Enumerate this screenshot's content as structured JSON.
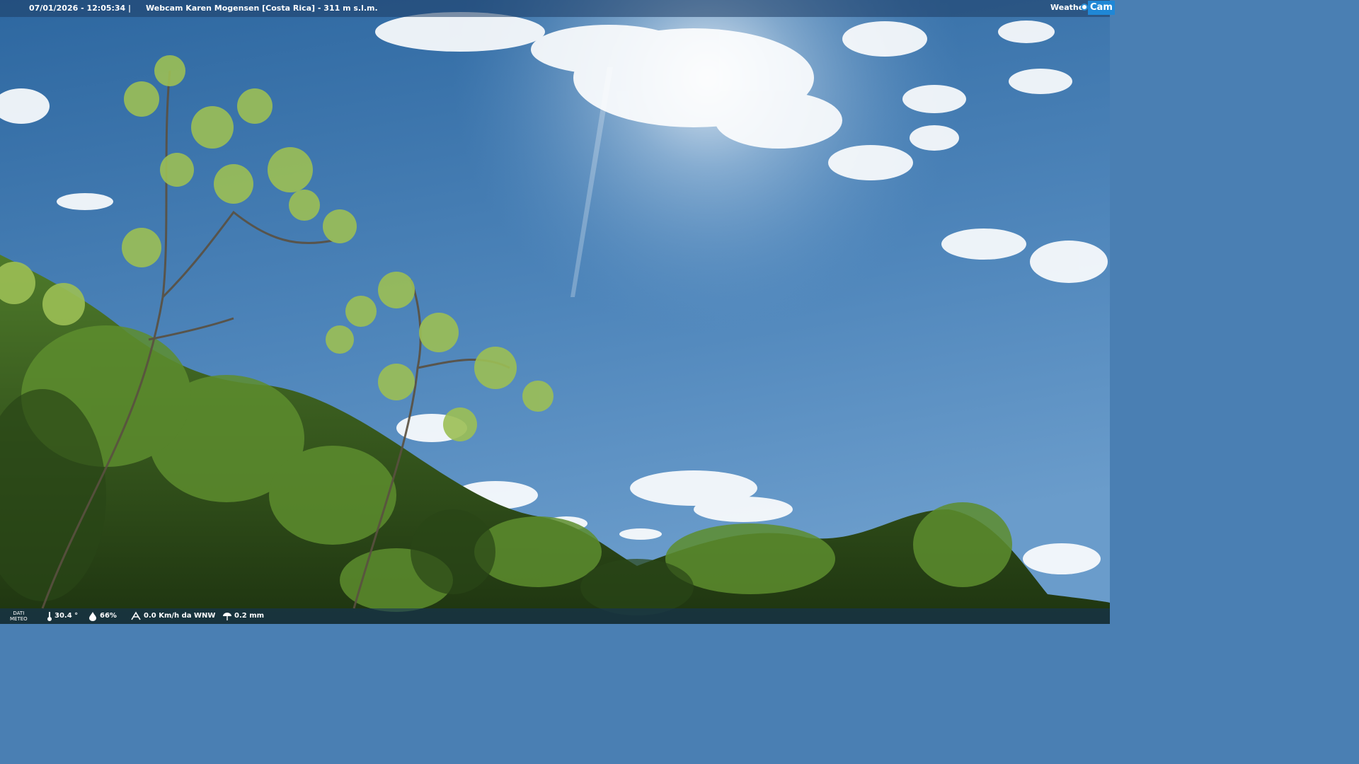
{
  "header": {
    "timestamp": "07/01/2026 - 12:05:34",
    "separator": "|",
    "title": "Webcam Karen Mogensen [Costa Rica] - 311 m s.l.m."
  },
  "logo": {
    "weather_text": "Weather",
    "cam_text": "Cam",
    "brand_color": "#1f87d6"
  },
  "weather_bar": {
    "label_line1": "DATI",
    "label_line2": "METEO",
    "temperature": "30.4 °",
    "humidity": "66%",
    "wind": "0.0 Km/h da WNW",
    "rain": "0.2 mm",
    "icons": [
      "thermometer-icon",
      "humidity-icon",
      "wind-icon",
      "rain-icon"
    ]
  },
  "scene": {
    "description_colors": {
      "sky_top": "#2f6aa3",
      "sky_bottom": "#5b8fc0",
      "foliage_dark": "#1f3a12",
      "foliage_light": "#6f9a3a"
    }
  }
}
